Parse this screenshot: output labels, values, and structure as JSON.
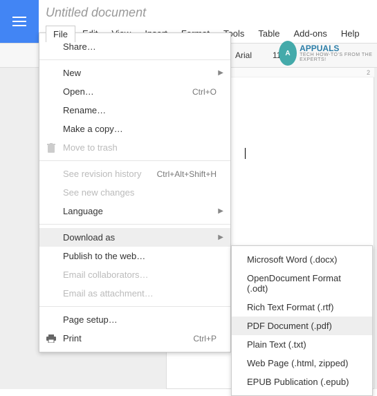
{
  "doc_title": "Untitled document",
  "menubar": [
    "File",
    "Edit",
    "View",
    "Insert",
    "Format",
    "Tools",
    "Table",
    "Add-ons",
    "Help"
  ],
  "toolbar": {
    "font": "Arial",
    "size": "11"
  },
  "file_menu": {
    "share": "Share…",
    "new": "New",
    "open": "Open…",
    "open_shortcut": "Ctrl+O",
    "rename": "Rename…",
    "makecopy": "Make a copy…",
    "trash": "Move to trash",
    "revision": "See revision history",
    "revision_shortcut": "Ctrl+Alt+Shift+H",
    "newchanges": "See new changes",
    "language": "Language",
    "download": "Download as",
    "publish": "Publish to the web…",
    "emailcollab": "Email collaborators…",
    "emailattach": "Email as attachment…",
    "pagesetup": "Page setup…",
    "print": "Print",
    "print_shortcut": "Ctrl+P"
  },
  "download_submenu": {
    "docx": "Microsoft Word (.docx)",
    "odt": "OpenDocument Format (.odt)",
    "rtf": "Rich Text Format (.rtf)",
    "pdf": "PDF Document (.pdf)",
    "txt": "Plain Text (.txt)",
    "html": "Web Page (.html, zipped)",
    "epub": "EPUB Publication (.epub)"
  },
  "watermark": {
    "brand": "APPUALS",
    "tagline": "TECH HOW-TO'S FROM THE EXPERTS!"
  },
  "ruler_mark": "2"
}
